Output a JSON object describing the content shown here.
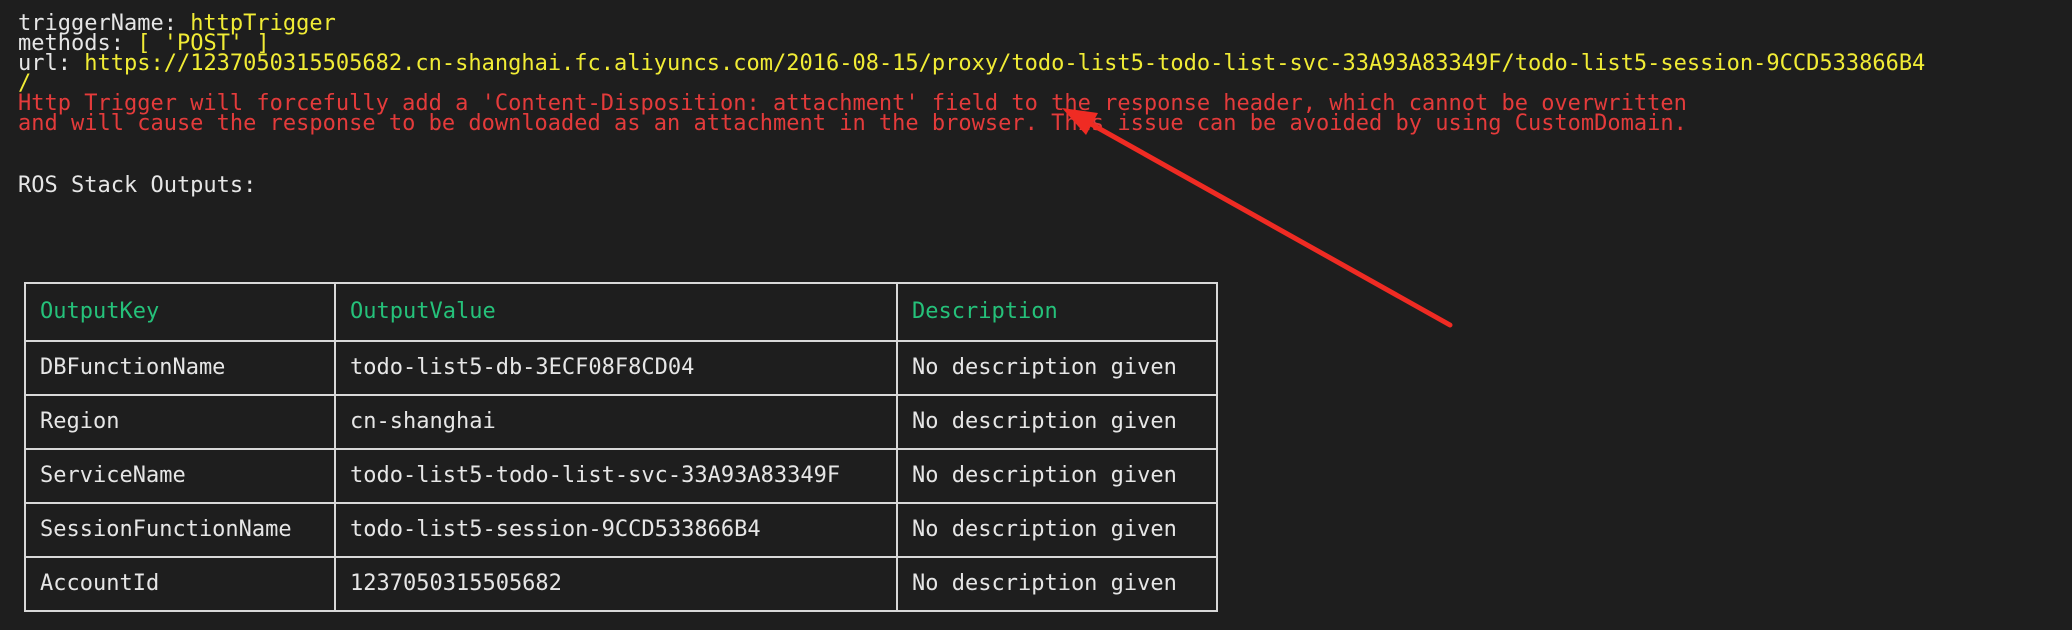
{
  "trigger": {
    "name_label": "triggerName: ",
    "name_value": "httpTrigger",
    "methods_label": "methods: ",
    "methods_value": "[ 'POST' ]",
    "url_label": "url: ",
    "url_value": "https://1237050315505682.cn-shanghai.fc.aliyuncs.com/2016-08-15/proxy/todo-list5-todo-list-svc-33A93A83349F/todo-list5-session-9CCD533866B4",
    "url_tail": "/"
  },
  "warning": {
    "line1": "Http Trigger will forcefully add a 'Content-Disposition: attachment' field to the response header, which cannot be overwritten",
    "line2": "and will cause the response to be downloaded as an attachment in the browser. This issue can be avoided by using CustomDomain."
  },
  "ros": {
    "heading": "ROS Stack Outputs:"
  },
  "table": {
    "headers": [
      "OutputKey",
      "OutputValue",
      "Description"
    ],
    "rows": [
      [
        "DBFunctionName",
        "todo-list5-db-3ECF08F8CD04",
        "No description given"
      ],
      [
        "Region",
        "cn-shanghai",
        "No description given"
      ],
      [
        "ServiceName",
        "todo-list5-todo-list-svc-33A93A83349F",
        "No description given"
      ],
      [
        "SessionFunctionName",
        "todo-list5-session-9CCD533866B4",
        "No description given"
      ],
      [
        "AccountId",
        "1237050315505682",
        "No description given"
      ]
    ]
  },
  "colors": {
    "background": "#1e1e1e",
    "text": "#e6e6e6",
    "yellow": "#f1ec35",
    "red": "#e43b3b",
    "green": "#25c17a",
    "arrow": "#ef2b23"
  },
  "annotation": {
    "icon": "red-arrow-icon"
  }
}
